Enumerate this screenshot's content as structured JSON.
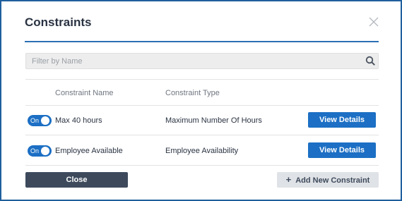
{
  "dialog": {
    "title": "Constraints",
    "close_icon": "close-icon"
  },
  "filter": {
    "placeholder": "Filter by Name",
    "value": "",
    "icon": "search-icon"
  },
  "table": {
    "columns": [
      "Constraint Name",
      "Constraint Type"
    ],
    "rows": [
      {
        "toggle_label": "On",
        "enabled": true,
        "name": "Max 40 hours",
        "type": "Maximum Number Of Hours",
        "action": "View Details"
      },
      {
        "toggle_label": "On",
        "enabled": true,
        "name": "Employee Available",
        "type": "Employee Availability",
        "action": "View Details"
      }
    ]
  },
  "footer": {
    "close_label": "Close",
    "add_icon": "plus-icon",
    "add_label": "Add New Constraint"
  },
  "colors": {
    "accent": "#1c6fc4",
    "border": "#1f5f9e",
    "close_button": "#3e4a5c",
    "add_button": "#dfe2e6"
  }
}
